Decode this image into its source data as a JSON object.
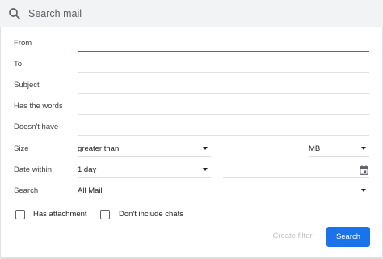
{
  "search": {
    "placeholder": "Search mail",
    "icon": "search-icon"
  },
  "filters": {
    "from_label": "From",
    "from_value": "",
    "to_label": "To",
    "to_value": "",
    "subject_label": "Subject",
    "subject_value": "",
    "has_words_label": "Has the words",
    "has_words_value": "",
    "doesnt_have_label": "Doesn't have",
    "doesnt_have_value": "",
    "size_label": "Size",
    "size_operator": "greater than",
    "size_value": "",
    "size_unit": "MB",
    "date_within_label": "Date within",
    "date_within_value": "1 day",
    "date_value": "",
    "date_icon": "calendar-icon",
    "search_label": "Search",
    "search_scope": "All Mail",
    "has_attachment_label": "Has attachment",
    "dont_include_chats_label": "Don't include chats"
  },
  "actions": {
    "create_filter_label": "Create filter",
    "search_label": "Search"
  },
  "colors": {
    "accent": "#1a73e8",
    "search_bar_bg": "#f1f3f4",
    "disabled_text": "#bdc1c6"
  }
}
